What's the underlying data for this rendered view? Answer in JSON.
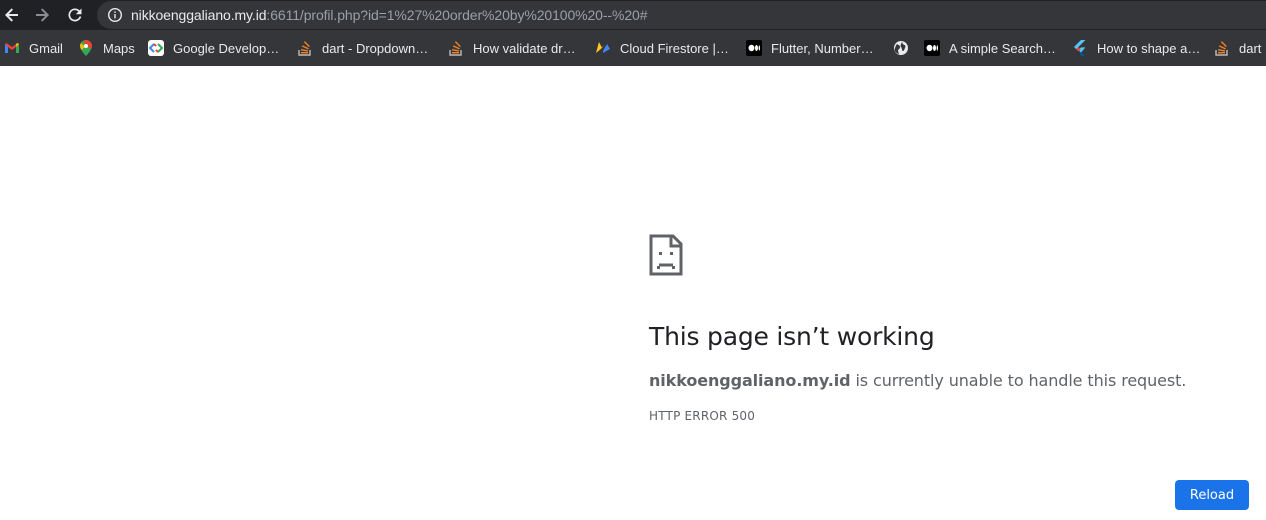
{
  "browser": {
    "url_host": "nikkoenggaliano.my.id",
    "url_rest": ":6611/profil.php?id=1%27%20order%20by%20100%20--%20#",
    "nav_icons": [
      "back-arrow-icon",
      "forward-arrow-icon",
      "reload-icon",
      "info-icon"
    ]
  },
  "bookmarks": [
    {
      "label": "Gmail",
      "icon": "gmail-icon"
    },
    {
      "label": "Maps",
      "icon": "maps-pin-icon"
    },
    {
      "label": "Google Develop…",
      "icon": "google-developers-icon"
    },
    {
      "label": "dart - Dropdown…",
      "icon": "stackoverflow-icon"
    },
    {
      "label": "How validate dr…",
      "icon": "stackoverflow-icon"
    },
    {
      "label": "Cloud Firestore |…",
      "icon": "firebase-icon"
    },
    {
      "label": "Flutter, Number…",
      "icon": "medium-icon"
    },
    {
      "label": "",
      "icon": "globe-icon"
    },
    {
      "label": "A simple Search…",
      "icon": "medium-icon"
    },
    {
      "label": "How to shape a…",
      "icon": "flutter-icon"
    },
    {
      "label": "dart",
      "icon": "stackoverflow-icon"
    }
  ],
  "error": {
    "icon": "sad-page-icon",
    "title": "This page isn’t working",
    "host": "nikkoenggaliano.my.id",
    "message": " is currently unable to handle this request.",
    "code": "HTTP ERROR 500",
    "reload_label": "Reload"
  },
  "colors": {
    "toolbar_bg": "#202124",
    "bookmarks_bg": "#35363a",
    "button_blue": "#1a73e8",
    "title_text": "#202124",
    "secondary_text": "#5f6368"
  }
}
